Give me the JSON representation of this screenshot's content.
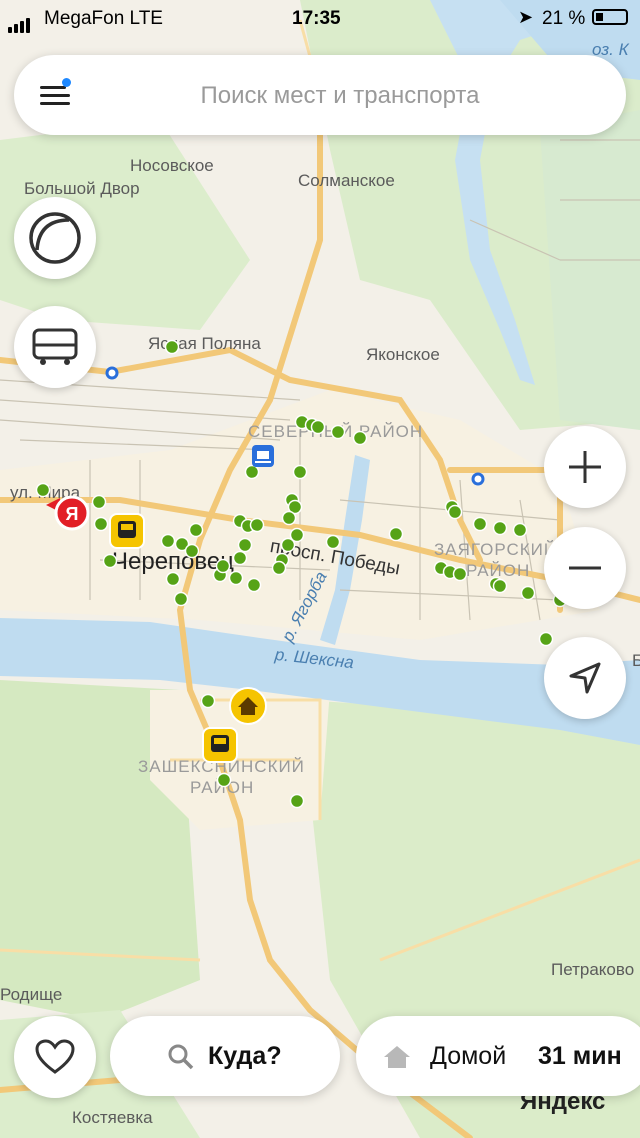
{
  "status_bar": {
    "carrier": "MegaFon LTE",
    "time": "17:35",
    "battery": "21 %"
  },
  "search": {
    "placeholder": "Поиск мест и транспорта"
  },
  "map_labels": {
    "noskovskoe": "Носовское",
    "bolshoy_dvor": "Большой Двор",
    "solmanskoe": "Солманское",
    "yasnaya_polyana": "Ясная Поляна",
    "yakonskoe": "Яконское",
    "severny_rayon": "СЕВЕРНЫЙ РАЙОН",
    "ul_mira": "ул. Мира",
    "cherepovets": "Череповец",
    "prospekt_pobedy": "просп. Победы",
    "zayagorsky_1": "ЗАЯГОРСКИЙ",
    "zayagorsky_2": "РАЙОН",
    "r_yagorba": "р. Ягорба",
    "r_sheksna": "р. Шексна",
    "zasheksninsky_1": "ЗАШЕКСНИНСКИЙ",
    "zasheksninsky_2": "РАЙОН",
    "oz": "оз. К",
    "petrakovo": "Петраково",
    "roditse": "Родище",
    "kostyaevka": "Костяевка",
    "b_edge": "Б",
    "yandex": "Яндекс",
    "ya_pin": "Я"
  },
  "bottom": {
    "where": "Куда?",
    "home": "Домой",
    "time": "31 мин"
  },
  "colors": {
    "stop_dot": "#56a316",
    "road": "#f6d18a",
    "water": "#bfdcf0",
    "greenery": "#d8ebc4"
  }
}
